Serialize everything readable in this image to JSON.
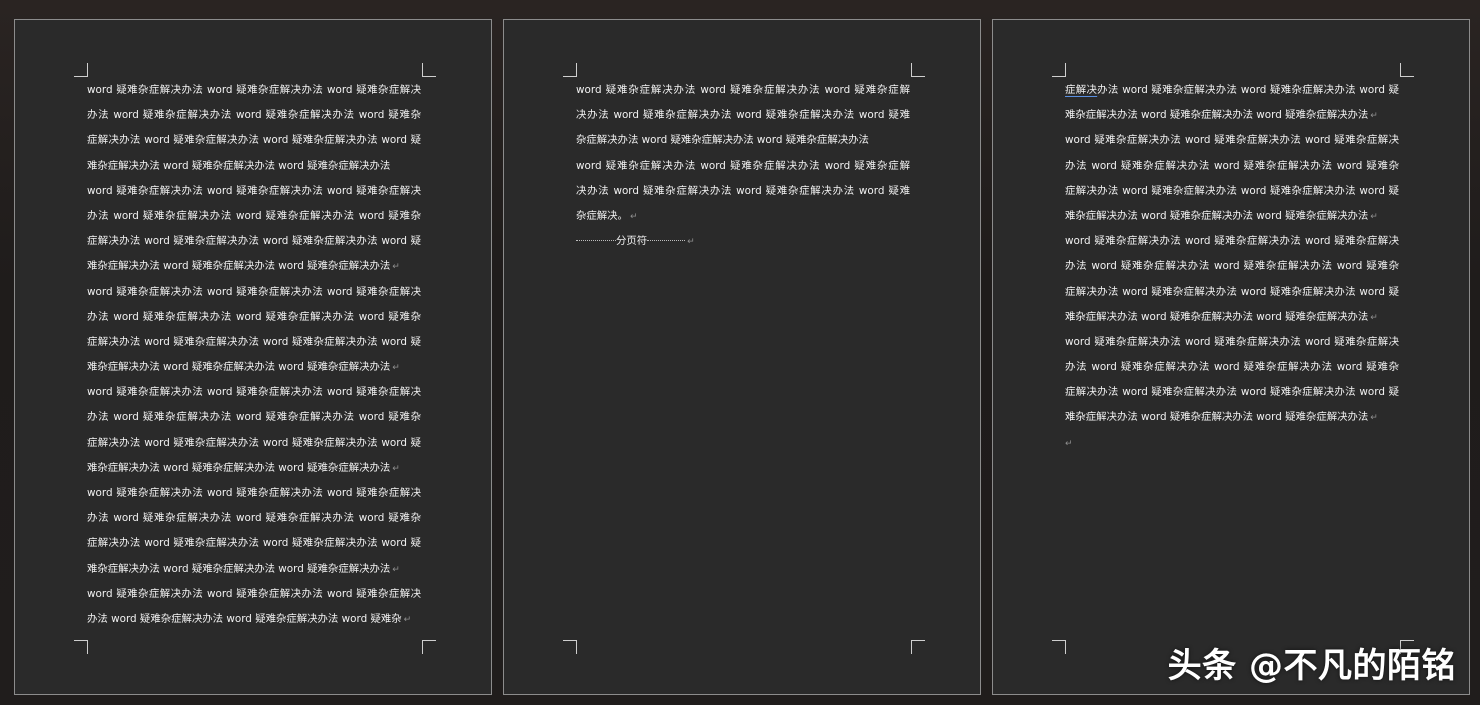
{
  "page1": {
    "lines": [
      "word 疑难杂症解决办法 word 疑难杂症解决办法 word 疑难杂症解决",
      "办法 word 疑难杂症解决办法 word 疑难杂症解决办法 word 疑难杂",
      "症解决办法 word 疑难杂症解决办法 word 疑难杂症解决办法 word 疑",
      "难杂症解决办法 word 疑难杂症解决办法 word 疑难杂症解决办法",
      "word 疑难杂症解决办法 word 疑难杂症解决办法 word 疑难杂症解决",
      "办法 word 疑难杂症解决办法 word 疑难杂症解决办法 word 疑难杂",
      "症解决办法 word 疑难杂症解决办法 word 疑难杂症解决办法 word 疑",
      "难杂症解决办法 word 疑难杂症解决办法 word 疑难杂症解决办法",
      "word 疑难杂症解决办法 word 疑难杂症解决办法 word 疑难杂症解决",
      "办法 word 疑难杂症解决办法 word 疑难杂症解决办法 word 疑难杂",
      "症解决办法 word 疑难杂症解决办法 word 疑难杂症解决办法 word 疑",
      "难杂症解决办法 word 疑难杂症解决办法 word 疑难杂症解决办法",
      "word 疑难杂症解决办法 word 疑难杂症解决办法 word 疑难杂症解决",
      "办法 word 疑难杂症解决办法 word 疑难杂症解决办法 word 疑难杂",
      "症解决办法 word 疑难杂症解决办法 word 疑难杂症解决办法 word 疑",
      "难杂症解决办法 word 疑难杂症解决办法 word 疑难杂症解决办法",
      "word 疑难杂症解决办法 word 疑难杂症解决办法 word 疑难杂症解决",
      "办法 word 疑难杂症解决办法 word 疑难杂症解决办法 word 疑难杂",
      "症解决办法 word 疑难杂症解决办法 word 疑难杂症解决办法 word 疑",
      "难杂症解决办法 word 疑难杂症解决办法 word 疑难杂症解决办法",
      "word 疑难杂症解决办法 word 疑难杂症解决办法 word 疑难杂症解决",
      "办法 word 疑难杂症解决办法 word 疑难杂症解决办法 word 疑难杂"
    ]
  },
  "page2": {
    "lines": [
      "word 疑难杂症解决办法 word 疑难杂症解决办法 word 疑难杂症解",
      "决办法 word 疑难杂症解决办法 word 疑难杂症解决办法 word 疑难",
      "杂症解决办法 word 疑难杂症解决办法 word 疑难杂症解决办法",
      "word 疑难杂症解决办法 word 疑难杂症解决办法 word 疑难杂症解",
      "决办法 word 疑难杂症解决办法 word 疑难杂症解决办法 word 疑难",
      "杂症解决。"
    ],
    "page_break_label": "分页符"
  },
  "page3": {
    "first_word": "症解决",
    "first_line_rest": "办法 word 疑难杂症解决办法 word 疑难杂症解决办法 word 疑",
    "lines": [
      "难杂症解决办法 word 疑难杂症解决办法 word 疑难杂症解决办法",
      "word 疑难杂症解决办法 word 疑难杂症解决办法 word 疑难杂症解决",
      "办法 word 疑难杂症解决办法 word 疑难杂症解决办法 word 疑难杂",
      "症解决办法 word 疑难杂症解决办法 word 疑难杂症解决办法 word 疑",
      "难杂症解决办法 word 疑难杂症解决办法 word 疑难杂症解决办法",
      "word 疑难杂症解决办法 word 疑难杂症解决办法 word 疑难杂症解决",
      "办法 word 疑难杂症解决办法 word 疑难杂症解决办法 word 疑难杂",
      "症解决办法 word 疑难杂症解决办法 word 疑难杂症解决办法 word 疑",
      "难杂症解决办法 word 疑难杂症解决办法 word 疑难杂症解决办法",
      "word 疑难杂症解决办法 word 疑难杂症解决办法 word 疑难杂症解决",
      "办法 word 疑难杂症解决办法 word 疑难杂症解决办法 word 疑难杂",
      "症解决办法 word 疑难杂症解决办法 word 疑难杂症解决办法 word 疑",
      "难杂症解决办法 word 疑难杂症解决办法 word 疑难杂症解决办法"
    ]
  },
  "marks": {
    "paragraph_mark": "↵"
  },
  "watermark": {
    "text": "头条 @不凡的陌铭"
  }
}
